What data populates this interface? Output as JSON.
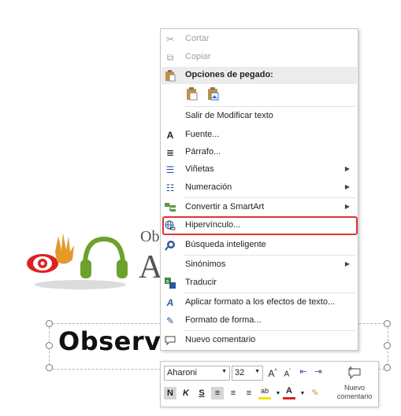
{
  "slide": {
    "title_partial_1": "Ob",
    "title_partial_2": "A",
    "textbox_text": "Observatorio"
  },
  "context_menu": {
    "cut": "Cortar",
    "copy": "Copiar",
    "paste_options": "Opciones de pegado:",
    "exit_edit": "Salir de Modificar texto",
    "font": "Fuente...",
    "paragraph": "Párrafo...",
    "bullets": "Viñetas",
    "numbering": "Numeración",
    "smartart": "Convertir a SmartArt",
    "hyperlink": "Hipervínculo...",
    "smart_lookup": "Búsqueda inteligente",
    "synonyms": "Sinónimos",
    "translate": "Traducir",
    "text_effects": "Aplicar formato a los efectos de texto...",
    "shape_format": "Formato de forma...",
    "new_comment": "Nuevo comentario"
  },
  "mini_toolbar": {
    "font_name": "Aharoni",
    "font_size": "32",
    "bold": "N",
    "italic": "K",
    "underline": "S",
    "new_comment_line1": "Nuevo",
    "new_comment_line2": "comentario"
  },
  "colors": {
    "highlight_border": "#e03333",
    "accent": "#2b579a"
  }
}
